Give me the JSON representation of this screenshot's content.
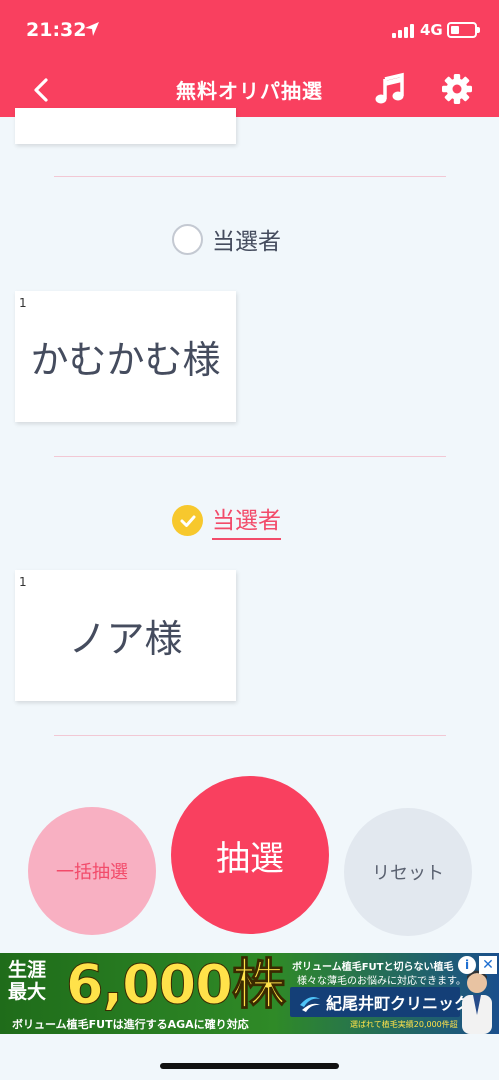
{
  "status_bar": {
    "time": "21:32",
    "network": "4G"
  },
  "nav": {
    "title": "無料オリパ抽選"
  },
  "results": [
    {
      "label": "当選者",
      "checked": false,
      "number": "1",
      "name": "かむかむ様"
    },
    {
      "label": "当選者",
      "checked": true,
      "number": "1",
      "name": "ノア様"
    }
  ],
  "buttons": {
    "bulk": "一括抽選",
    "draw": "抽選",
    "reset": "リセット"
  },
  "ad": {
    "left_line1": "生涯",
    "left_line2": "最大",
    "headline": "6,000株",
    "text1": "ボリューム植毛FUTと切らない植毛",
    "text2": "様々な薄毛のお悩みに対応できます。",
    "bottom": "ボリューム植毛FUTは進行するAGAに確り対応",
    "clinic": "紀尾井町クリニック",
    "clinic_sub": "選ばれて植毛実績20,000件超",
    "info_glyph": "i",
    "close_glyph": "✕"
  },
  "colors": {
    "primary": "#f9405f",
    "checked": "#f7c82d",
    "text": "#454c5e"
  }
}
